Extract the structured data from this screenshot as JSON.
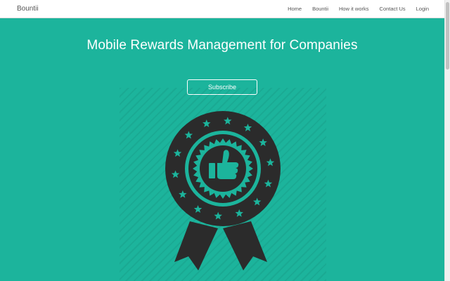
{
  "brand": "Bountii",
  "nav": {
    "items": [
      {
        "label": "Home"
      },
      {
        "label": "Bountii"
      },
      {
        "label": "How it works"
      },
      {
        "label": "Contact Us"
      },
      {
        "label": "Login"
      }
    ]
  },
  "hero": {
    "headline": "Mobile Rewards Management for Companies",
    "subscribe_label": "Subscribe",
    "badge_icon": "award-ribbon-thumbs-up-icon"
  },
  "colors": {
    "background": "#1cb49c",
    "badge": "#2b2b2b",
    "navbar": "#ffffff"
  }
}
